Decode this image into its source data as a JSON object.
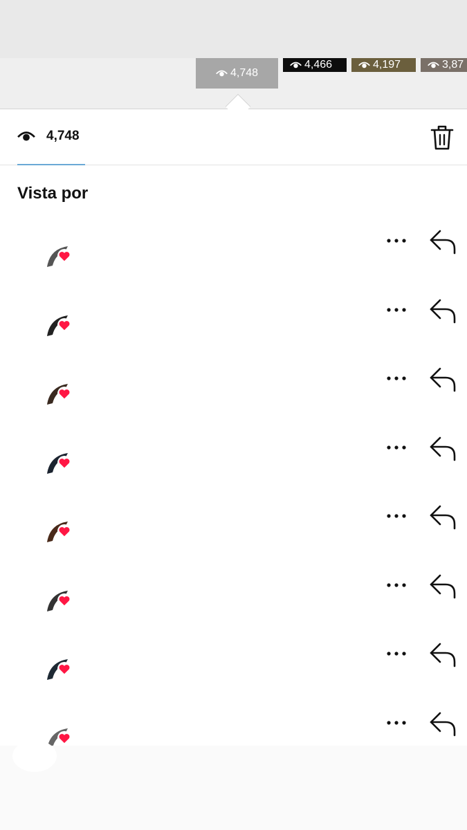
{
  "story_thumbnails": [
    {
      "views": "4,748",
      "selected": true
    },
    {
      "views": "4,466"
    },
    {
      "views": "4,197"
    },
    {
      "views": "3,87"
    }
  ],
  "stats": {
    "views": "4,748"
  },
  "section_title": "Vista por",
  "viewers": [
    {
      "id": 1
    },
    {
      "id": 2
    },
    {
      "id": 3
    },
    {
      "id": 4
    },
    {
      "id": 5
    },
    {
      "id": 6
    },
    {
      "id": 7
    },
    {
      "id": 8
    }
  ],
  "colors": {
    "heart": "#ff1744",
    "tab_underline": "#6aa9d6",
    "selected_thumb": "#a7a7a7"
  }
}
